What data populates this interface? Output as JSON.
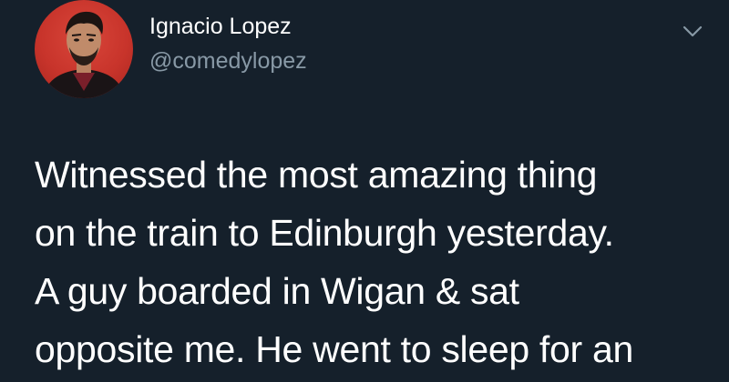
{
  "tweet": {
    "author": {
      "display_name": "Ignacio Lopez",
      "handle": "@comedylopez",
      "avatar_icon": "profile-photo"
    },
    "menu_icon": "chevron-down-icon",
    "text_lines": [
      "Witnessed the most amazing thing",
      "on the train to Edinburgh yesterday.",
      "A guy boarded in Wigan & sat",
      "opposite me. He went to sleep for an"
    ]
  },
  "colors": {
    "background": "#15202b",
    "primary_text": "#ffffff",
    "secondary_text": "#8899a6",
    "avatar_background": "#c8342b"
  }
}
